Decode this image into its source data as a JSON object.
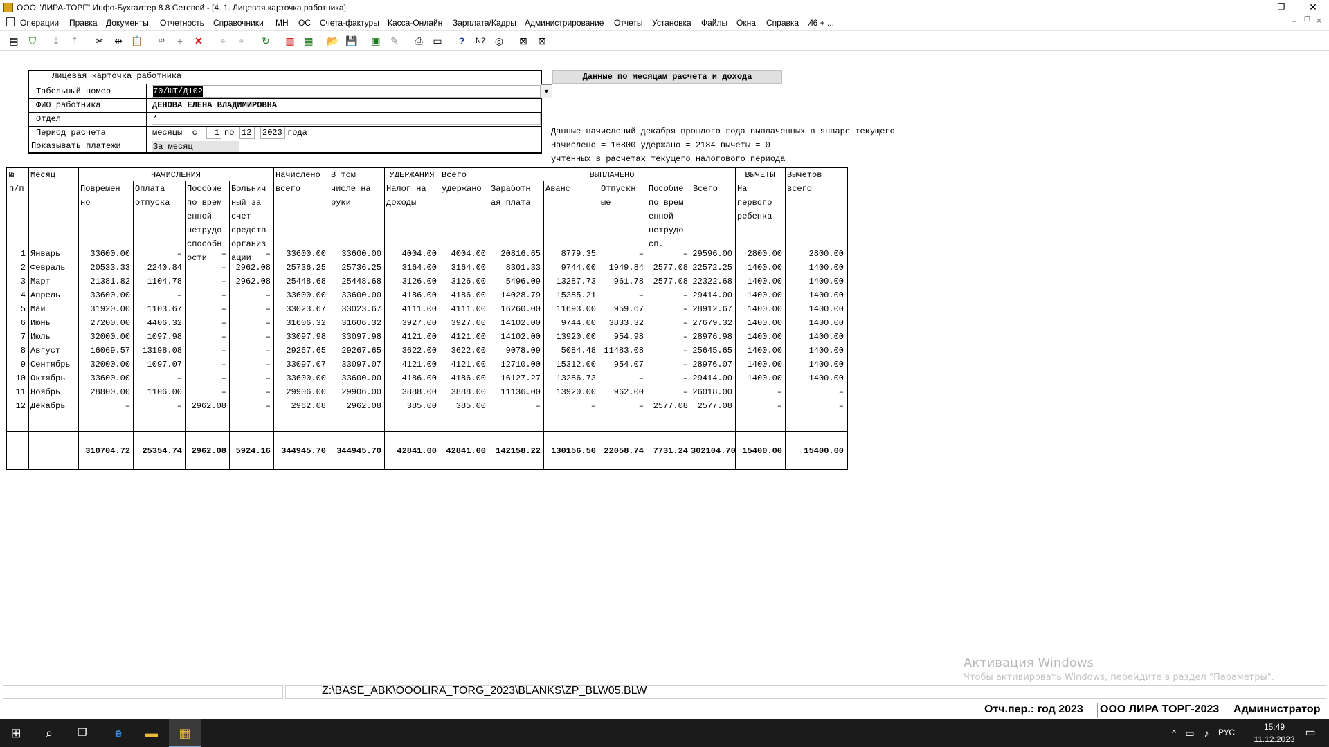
{
  "window": {
    "title": "ООО \"ЛИРА-ТОРГ\" Инфо-Бухгалтер 8.8 Сетевой - [4. 1. Лицевая карточка работника]",
    "min": "–",
    "max": "❐",
    "close": "✕"
  },
  "menu": [
    "Операции",
    "Правка",
    "Документы",
    "Отчетность",
    "Справочники",
    "МН",
    "ОС",
    "Счета-фактуры",
    "Касса-Онлайн",
    "Зарплата/Кадры",
    "Администрирование",
    "Отчеты",
    "Установка",
    "Файлы",
    "Окна",
    "Справка",
    "И6 + ..."
  ],
  "card": {
    "title": "Лицевая карточка работника",
    "rows": [
      {
        "label": "Табельный номер",
        "value": "70/ШТ/Д102"
      },
      {
        "label": "ФИО работника",
        "value": "ДЕНОВА ЕЛЕНА ВЛАДИМИРОВНА"
      },
      {
        "label": "Отдел",
        "value": "*"
      },
      {
        "label": "Период расчета",
        "value": "месяцы  с"
      },
      {
        "label": "Показывать платежи",
        "value": "За месяц"
      }
    ],
    "period_from": "1",
    "period_to_word": "по",
    "period_to": "12",
    "period_year": "2023",
    "period_year_word": "года"
  },
  "month_button": "Данные по месяцам расчета и дохода",
  "info": {
    "line1": "Данные начислений декабря прошлого года выплаченных в январе текущего",
    "line2": "Начислено = 16800 удержано = 2184 вычеты = 0",
    "line3": "учтенных в расчетах текущего налогового периода"
  },
  "grid": {
    "group_headers": {
      "nach": "НАЧИСЛЕНИЯ",
      "ud": "УДЕРЖАНИЯ",
      "vypl": "ВЫПЛАЧЕНО",
      "vych": "ВЫЧЕТЫ"
    },
    "headers": [
      [
        "№",
        "п/п"
      ],
      [
        "Месяц"
      ],
      [
        "Повремен",
        "но"
      ],
      [
        "Оплата",
        "отпуска"
      ],
      [
        "Пособие",
        "по врем",
        "енной",
        "нетрудо",
        "способн",
        "ости"
      ],
      [
        "Больнич",
        "ный за",
        "счет",
        "средств",
        "организ",
        "ации"
      ],
      [
        "Начислено",
        "всего"
      ],
      [
        "В том",
        "числе на",
        "руки"
      ],
      [
        "Налог на",
        "доходы"
      ],
      [
        "Всего",
        "удержано"
      ],
      [
        "Заработн",
        "ая плата"
      ],
      [
        "Аванс"
      ],
      [
        "Отпускн",
        "ые"
      ],
      [
        "Пособие",
        "по врем",
        "енной",
        "нетрудо",
        "сп."
      ],
      [
        "Всего"
      ],
      [
        "На",
        "первого",
        "ребенка"
      ],
      [
        "Вычетов",
        "всего"
      ]
    ],
    "rows": [
      [
        "1",
        "Январь",
        "33600.00",
        "–",
        "–",
        "–",
        "33600.00",
        "33600.00",
        "4004.00",
        "4004.00",
        "20816.65",
        "8779.35",
        "–",
        "–",
        "29596.00",
        "2800.00",
        "2800.00"
      ],
      [
        "2",
        "Февраль",
        "20533.33",
        "2240.84",
        "–",
        "2962.08",
        "25736.25",
        "25736.25",
        "3164.00",
        "3164.00",
        "8301.33",
        "9744.00",
        "1949.84",
        "2577.08",
        "22572.25",
        "1400.00",
        "1400.00"
      ],
      [
        "3",
        "Март",
        "21381.82",
        "1104.78",
        "–",
        "2962.08",
        "25448.68",
        "25448.68",
        "3126.00",
        "3126.00",
        "5496.09",
        "13287.73",
        "961.78",
        "2577.08",
        "22322.68",
        "1400.00",
        "1400.00"
      ],
      [
        "4",
        "Апрель",
        "33600.00",
        "–",
        "–",
        "–",
        "33600.00",
        "33600.00",
        "4186.00",
        "4186.00",
        "14028.79",
        "15385.21",
        "–",
        "–",
        "29414.00",
        "1400.00",
        "1400.00"
      ],
      [
        "5",
        "Май",
        "31920.00",
        "1103.67",
        "–",
        "–",
        "33023.67",
        "33023.67",
        "4111.00",
        "4111.00",
        "16260.00",
        "11693.00",
        "959.67",
        "–",
        "28912.67",
        "1400.00",
        "1400.00"
      ],
      [
        "6",
        "Июнь",
        "27200.00",
        "4406.32",
        "–",
        "–",
        "31606.32",
        "31606.32",
        "3927.00",
        "3927.00",
        "14102.00",
        "9744.00",
        "3833.32",
        "–",
        "27679.32",
        "1400.00",
        "1400.00"
      ],
      [
        "7",
        "Июль",
        "32000.00",
        "1097.98",
        "–",
        "–",
        "33097.98",
        "33097.98",
        "4121.00",
        "4121.00",
        "14102.00",
        "13920.00",
        "954.98",
        "–",
        "28976.98",
        "1400.00",
        "1400.00"
      ],
      [
        "8",
        "Август",
        "16069.57",
        "13198.08",
        "–",
        "–",
        "29267.65",
        "29267.65",
        "3622.00",
        "3622.00",
        "9078.09",
        "5084.48",
        "11483.08",
        "–",
        "25645.65",
        "1400.00",
        "1400.00"
      ],
      [
        "9",
        "Сентябрь",
        "32000.00",
        "1097.07",
        "–",
        "–",
        "33097.07",
        "33097.07",
        "4121.00",
        "4121.00",
        "12710.00",
        "15312.00",
        "954.07",
        "–",
        "28976.07",
        "1400.00",
        "1400.00"
      ],
      [
        "10",
        "Октябрь",
        "33600.00",
        "–",
        "–",
        "–",
        "33600.00",
        "33600.00",
        "4186.00",
        "4186.00",
        "16127.27",
        "13286.73",
        "–",
        "–",
        "29414.00",
        "1400.00",
        "1400.00"
      ],
      [
        "11",
        "Ноябрь",
        "28800.00",
        "1106.00",
        "–",
        "–",
        "29906.00",
        "29906.00",
        "3888.00",
        "3888.00",
        "11136.00",
        "13920.00",
        "962.00",
        "–",
        "26018.00",
        "–",
        "–"
      ],
      [
        "12",
        "Декабрь",
        "–",
        "–",
        "2962.08",
        "–",
        "2962.08",
        "2962.08",
        "385.00",
        "385.00",
        "–",
        "–",
        "–",
        "2577.08",
        "2577.08",
        "–",
        "–"
      ]
    ],
    "totals": [
      "",
      "",
      "310704.72",
      "25354.74",
      "2962.08",
      "5924.16",
      "344945.70",
      "344945.70",
      "42841.00",
      "42841.00",
      "142158.22",
      "130156.50",
      "22058.74",
      "7731.24",
      "302104.70",
      "15400.00",
      "15400.00"
    ]
  },
  "statusbar": {
    "path": "Z:\\BASE_ABK\\OOOLIRA_TORG_2023\\BLANKS\\ZP_BLW05.BLW",
    "period": "Отч.пер.: год 2023",
    "org": "ООО ЛИРА ТОРГ-2023",
    "user": "Администратор"
  },
  "watermark": {
    "line1": "Активация Windows",
    "line2": "Чтобы активировать Windows, перейдите в раздел \"Параметры\"."
  },
  "taskbar": {
    "lang": "РУС",
    "time": "15:49",
    "date": "11.12.2023"
  }
}
